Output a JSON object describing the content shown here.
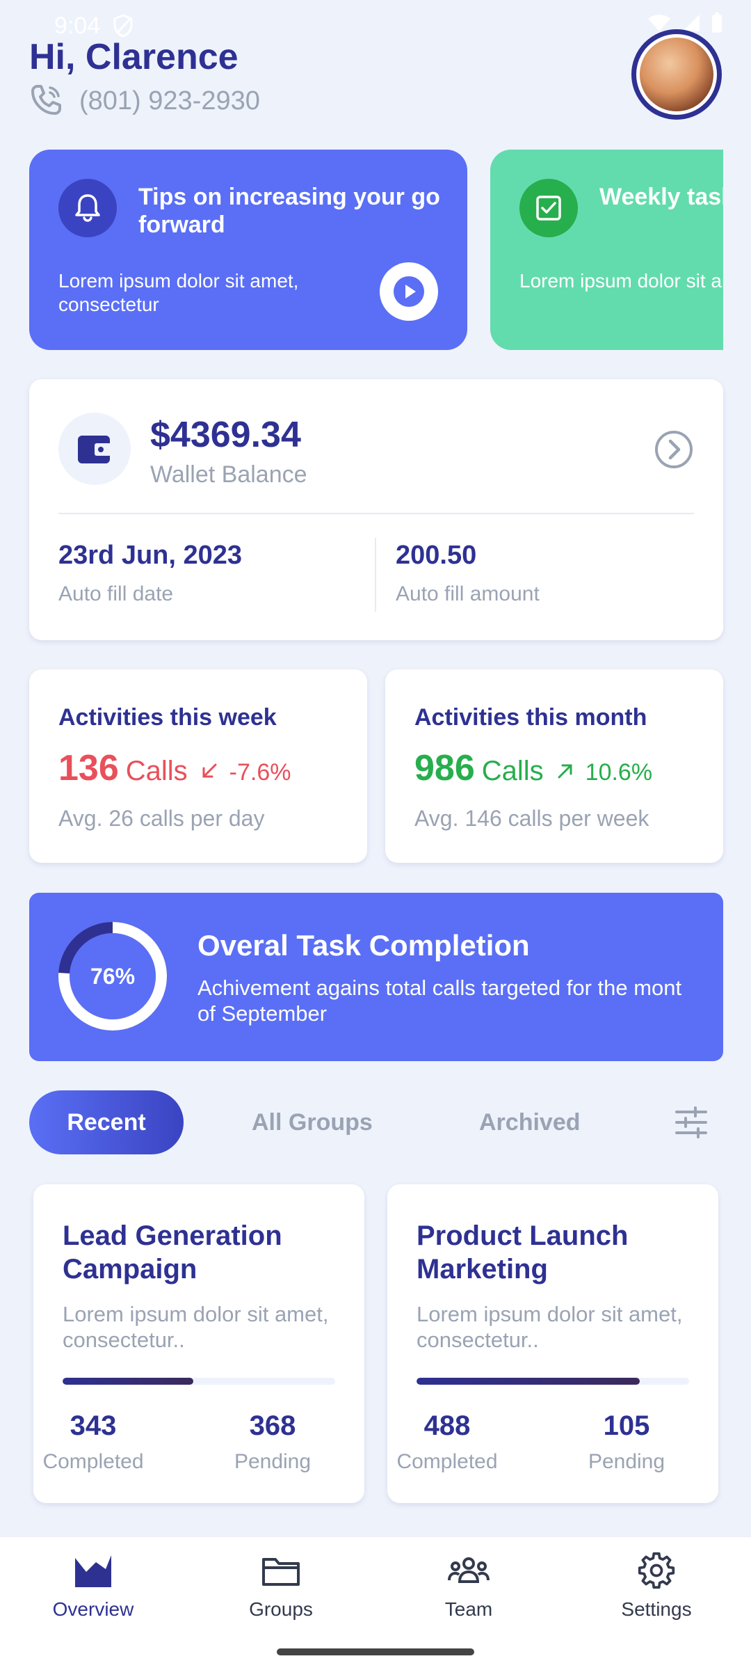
{
  "status_bar": {
    "time": "9:04"
  },
  "header": {
    "greeting": "Hi, Clarence",
    "phone": "(801) 923-2930",
    "avatar_icon": "user-avatar"
  },
  "promos": [
    {
      "title": "Tips on increasing your go forward",
      "desc": "Lorem ipsum dolor sit amet, consectetur",
      "icon": "bell-icon",
      "color": "#5a6ff5"
    },
    {
      "title": "Weekly task completed!",
      "desc": "Lorem ipsum dolor sit amet, consectetur",
      "icon": "check-square-icon",
      "color": "#62dcad"
    }
  ],
  "wallet": {
    "amount": "$4369.34",
    "label": "Wallet Balance",
    "autofill_date": "23rd Jun, 2023",
    "autofill_date_label": "Auto fill date",
    "autofill_amount": "200.50",
    "autofill_amount_label": "Auto fill amount"
  },
  "activities": [
    {
      "title": "Activities this week",
      "count": "136",
      "unit": "Calls",
      "change": "-7.6%",
      "avg": "Avg. 26 calls per day",
      "trend": "down",
      "color": "#e8505b"
    },
    {
      "title": "Activities this month",
      "count": "986",
      "unit": "Calls",
      "change": "10.6%",
      "avg": "Avg. 146 calls per week",
      "trend": "up",
      "color": "#27ae4d"
    }
  ],
  "task": {
    "percent_label": "76%",
    "percent": 76,
    "title": "Overal Task Completion",
    "desc": "Achivement agains total calls targeted for the mont of September"
  },
  "tabs": {
    "active": "Recent",
    "items": [
      "Recent",
      "All Groups",
      "Archived"
    ]
  },
  "groups": [
    {
      "title": "Lead Generation Campaign",
      "desc": "Lorem ipsum dolor sit amet, consectetur..",
      "completed": "343",
      "pending": "368",
      "completed_label": "Completed",
      "pending_label": "Pending",
      "progress": 0.48
    },
    {
      "title": "Product Launch Marketing",
      "desc": "Lorem ipsum dolor sit amet, consectetur..",
      "completed": "488",
      "pending": "105",
      "completed_label": "Completed",
      "pending_label": "Pending",
      "progress": 0.82
    }
  ],
  "nav": {
    "items": [
      {
        "label": "Overview",
        "icon": "chart-area-icon"
      },
      {
        "label": "Groups",
        "icon": "folder-icon"
      },
      {
        "label": "Team",
        "icon": "team-icon"
      },
      {
        "label": "Settings",
        "icon": "gear-icon"
      }
    ],
    "active": "Overview"
  }
}
